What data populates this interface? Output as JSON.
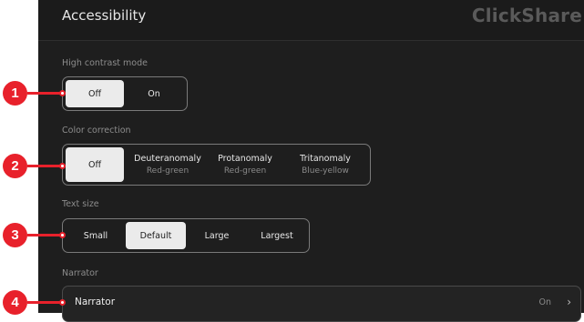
{
  "header": {
    "title": "Accessibility",
    "brand": "ClickShare"
  },
  "high_contrast": {
    "label": "High contrast mode",
    "options": [
      "Off",
      "On"
    ],
    "selected": "Off"
  },
  "color_correction": {
    "label": "Color correction",
    "options": [
      {
        "title": "Off",
        "subtitle": ""
      },
      {
        "title": "Deuteranomaly",
        "subtitle": "Red-green"
      },
      {
        "title": "Protanomaly",
        "subtitle": "Red-green"
      },
      {
        "title": "Tritanomaly",
        "subtitle": "Blue-yellow"
      }
    ],
    "selected": "Off"
  },
  "text_size": {
    "label": "Text size",
    "options": [
      "Small",
      "Default",
      "Large",
      "Largest"
    ],
    "selected": "Default"
  },
  "narrator": {
    "section_label": "Narrator",
    "row_label": "Narrator",
    "value": "On",
    "chevron_icon": "chevron-right-icon"
  },
  "callouts": [
    "1",
    "2",
    "3",
    "4"
  ],
  "colors": {
    "background": "#1e1e1e",
    "selected": "#ebebeb",
    "callout": "#e8212b"
  }
}
